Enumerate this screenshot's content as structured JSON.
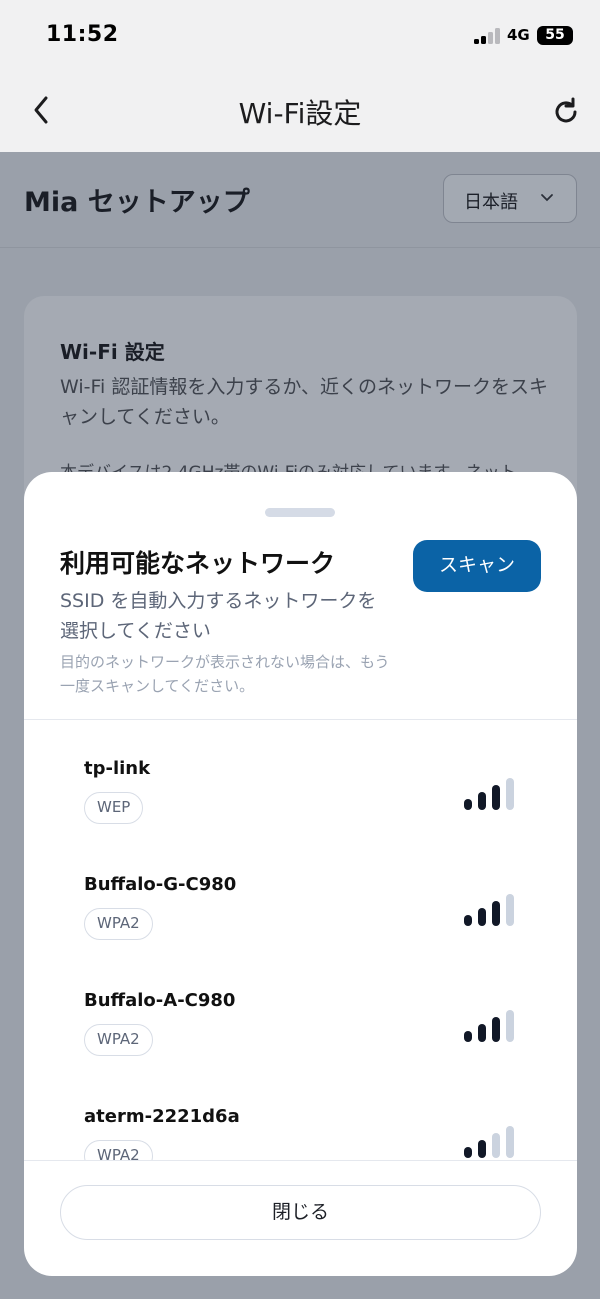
{
  "status_bar": {
    "time": "11:52",
    "network": "4G",
    "battery": "55"
  },
  "nav": {
    "title": "Wi-Fi設定",
    "back_icon": "chevron-left-icon",
    "refresh_icon": "refresh-icon"
  },
  "page": {
    "title": "Mia セットアップ",
    "language": {
      "selected": "日本語"
    },
    "card": {
      "title": "Wi-Fi 設定",
      "description": "Wi-Fi 認証情報を入力するか、近くのネットワークをスキャンしてください。",
      "note": "本デバイスは2.4GHz帯のWi-Fiのみ対応しています。ネット"
    }
  },
  "sheet": {
    "title": "利用可能なネットワーク",
    "scan_label": "スキャン",
    "subtitle": "SSID を自動入力するネットワークを選択してください",
    "hint": "目的のネットワークが表示されない場合は、もう一度スキャンしてください。",
    "close_label": "閉じる",
    "networks": [
      {
        "ssid": "tp-link",
        "security": "WEP",
        "signal_bars": 3
      },
      {
        "ssid": "Buffalo-G-C980",
        "security": "WPA2",
        "signal_bars": 3
      },
      {
        "ssid": "Buffalo-A-C980",
        "security": "WPA2",
        "signal_bars": 3
      },
      {
        "ssid": "aterm-2221d6a",
        "security": "WPA2",
        "signal_bars": 2
      }
    ]
  },
  "colors": {
    "accent": "#0b63a6",
    "signal_on": "#111827",
    "signal_off": "#cbd3df"
  }
}
